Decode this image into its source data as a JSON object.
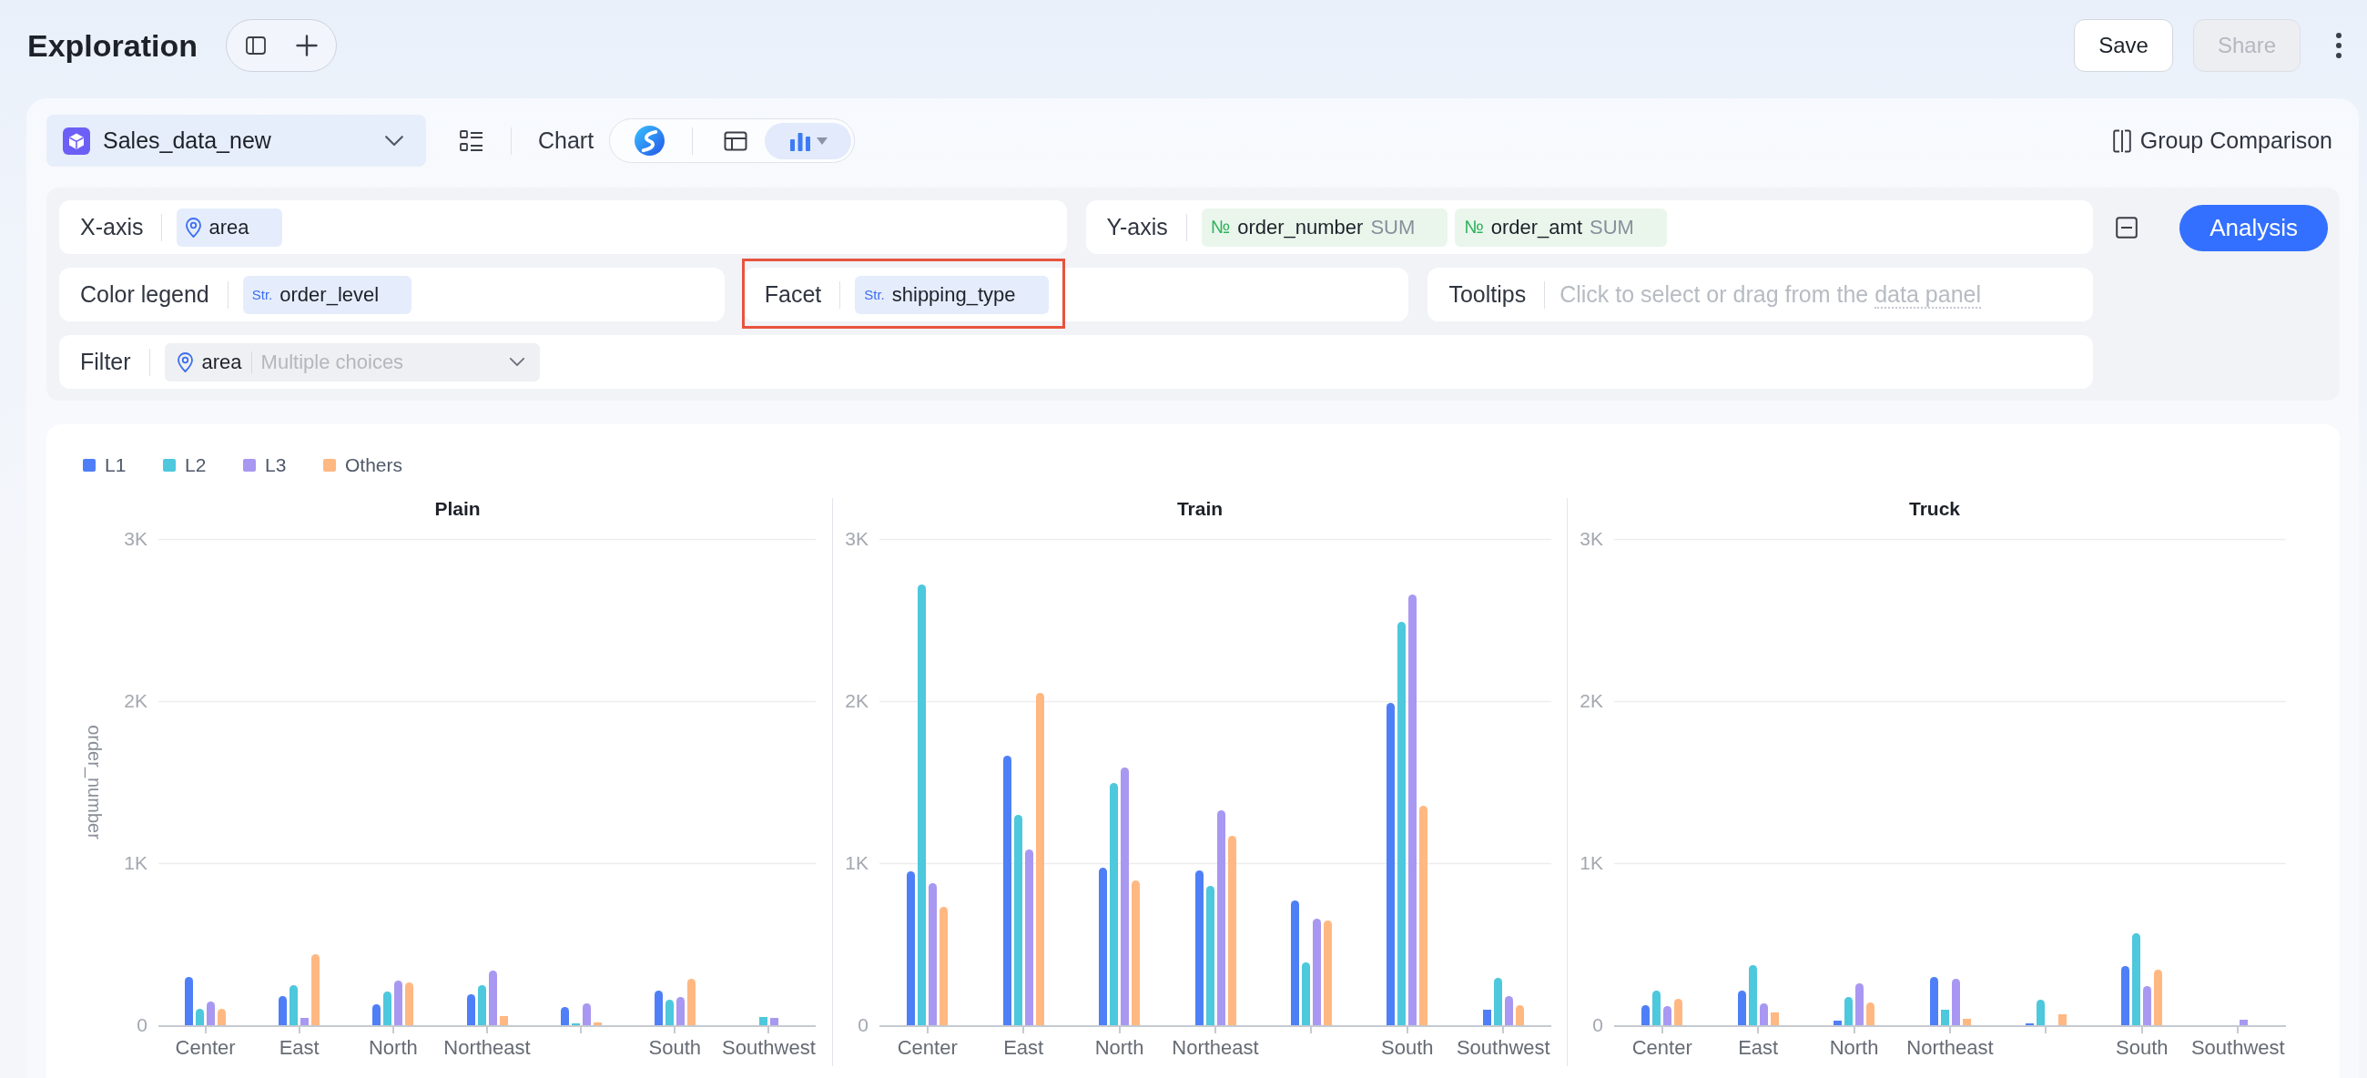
{
  "header": {
    "title": "Exploration",
    "actions": [
      {
        "label": "Save",
        "disabled": false
      },
      {
        "label": "Share",
        "disabled": true
      }
    ]
  },
  "toolbar": {
    "dataset": "Sales_data_new",
    "chart_label": "Chart",
    "chart_types": [
      {
        "kind": "smart",
        "selected": false
      },
      {
        "kind": "table",
        "selected": false
      },
      {
        "kind": "bar",
        "selected": true
      }
    ],
    "group_comparison": "Group Comparison"
  },
  "config": {
    "rows": [
      {
        "fields": [
          {
            "label": "X-axis",
            "highlighted": false,
            "chips": [
              {
                "kind": "geo",
                "name": "area"
              }
            ]
          },
          {
            "label": "Y-axis",
            "highlighted": false,
            "chips": [
              {
                "kind": "number",
                "type_label": "№",
                "name": "order_number",
                "aggregate": "SUM"
              },
              {
                "kind": "number",
                "type_label": "№",
                "name": "order_amt",
                "aggregate": "SUM"
              }
            ]
          }
        ]
      },
      {
        "fields": [
          {
            "label": "Color legend",
            "highlighted": false,
            "chips": [
              {
                "kind": "string",
                "type_label": "Str.",
                "name": "order_level"
              }
            ]
          },
          {
            "label": "Facet",
            "highlighted": true,
            "chips": [
              {
                "kind": "string",
                "type_label": "Str.",
                "name": "shipping_type"
              }
            ]
          },
          {
            "label": "Tooltips",
            "highlighted": false,
            "placeholder": "Click to select or drag from the",
            "placeholder_link": "data panel"
          }
        ]
      },
      {
        "fields": [
          {
            "label": "Filter",
            "highlighted": false,
            "chips": [
              {
                "kind": "select",
                "name": "area",
                "placeholder": "Multiple choices"
              }
            ]
          }
        ]
      }
    ],
    "action": "Analysis"
  },
  "chart": {
    "facets": [
      {
        "chart_data": {
          "type": "bar",
          "title": "Plain",
          "ylabel": "order_number",
          "categories": [
            "Center",
            "East",
            "North",
            "Northeast",
            null,
            "South",
            "Southwest"
          ],
          "series": [
            {
              "name": "L1",
              "color": "#4f7ff7",
              "values": [
                295,
                182,
                129,
                189,
                113,
                212,
                null
              ]
            },
            {
              "name": "L2",
              "color": "#4dc8dc",
              "values": [
                103,
                245,
                209,
                249,
                7,
                159,
                53
              ]
            },
            {
              "name": "L3",
              "color": "#a898f2",
              "values": [
                146,
                43,
                275,
                338,
                136,
                172,
                46
              ]
            },
            {
              "name": "Others",
              "color": "#ffb882",
              "values": [
                100,
                441,
                262,
                56,
                17,
                285,
                null
              ]
            }
          ],
          "stacked": false,
          "ylim": [
            0,
            3000
          ],
          "yticks": [
            {
              "value": 0,
              "label": "0"
            },
            {
              "value": 1000,
              "label": "1K"
            },
            {
              "value": 2000,
              "label": "2K"
            },
            {
              "value": 3000,
              "label": "3K"
            }
          ]
        }
      },
      {
        "chart_data": {
          "type": "bar",
          "title": "Train",
          "categories": [
            "Center",
            "East",
            "North",
            "Northeast",
            null,
            "South",
            "Southwest"
          ],
          "series": [
            {
              "color": "#4f7ff7",
              "values": [
                951,
                1661,
                970,
                954,
                768,
                1986,
                93
              ]
            },
            {
              "color": "#4dc8dc",
              "values": [
                2721,
                1298,
                1494,
                861,
                387,
                2488,
                294
              ]
            },
            {
              "color": "#a898f2",
              "values": [
                874,
                1082,
                1590,
                1326,
                660,
                2656,
                177
              ]
            },
            {
              "color": "#ffb882",
              "values": [
                728,
                2051,
                896,
                1168,
                648,
                1354,
                124
              ]
            }
          ],
          "stacked": false,
          "ylim": [
            0,
            3000
          ],
          "yticks": [
            {
              "value": 0,
              "label": "0"
            },
            {
              "value": 1000,
              "label": "1K"
            },
            {
              "value": 2000,
              "label": "2K"
            },
            {
              "value": 3000,
              "label": "3K"
            }
          ]
        }
      },
      {
        "chart_data": {
          "type": "bar",
          "title": "Truck",
          "categories": [
            "Center",
            "East",
            "North",
            "Northeast",
            null,
            "South",
            "Southwest"
          ],
          "series": [
            {
              "color": "#4f7ff7",
              "values": [
                126,
                211,
                29,
                298,
                6,
                363,
                null
              ]
            },
            {
              "color": "#4dc8dc",
              "values": [
                211,
                373,
                175,
                97,
                155,
                570,
                null
              ]
            },
            {
              "color": "#a898f2",
              "values": [
                117,
                133,
                259,
                285,
                null,
                240,
                36
              ]
            },
            {
              "color": "#ffb882",
              "values": [
                165,
                81,
                139,
                39,
                65,
                340,
                null
              ]
            }
          ],
          "stacked": false,
          "ylim": [
            0,
            3000
          ],
          "yticks": [
            {
              "value": 0,
              "label": "0"
            },
            {
              "value": 1000,
              "label": "1K"
            },
            {
              "value": 2000,
              "label": "2K"
            },
            {
              "value": 3000,
              "label": "3K"
            }
          ]
        }
      }
    ]
  }
}
